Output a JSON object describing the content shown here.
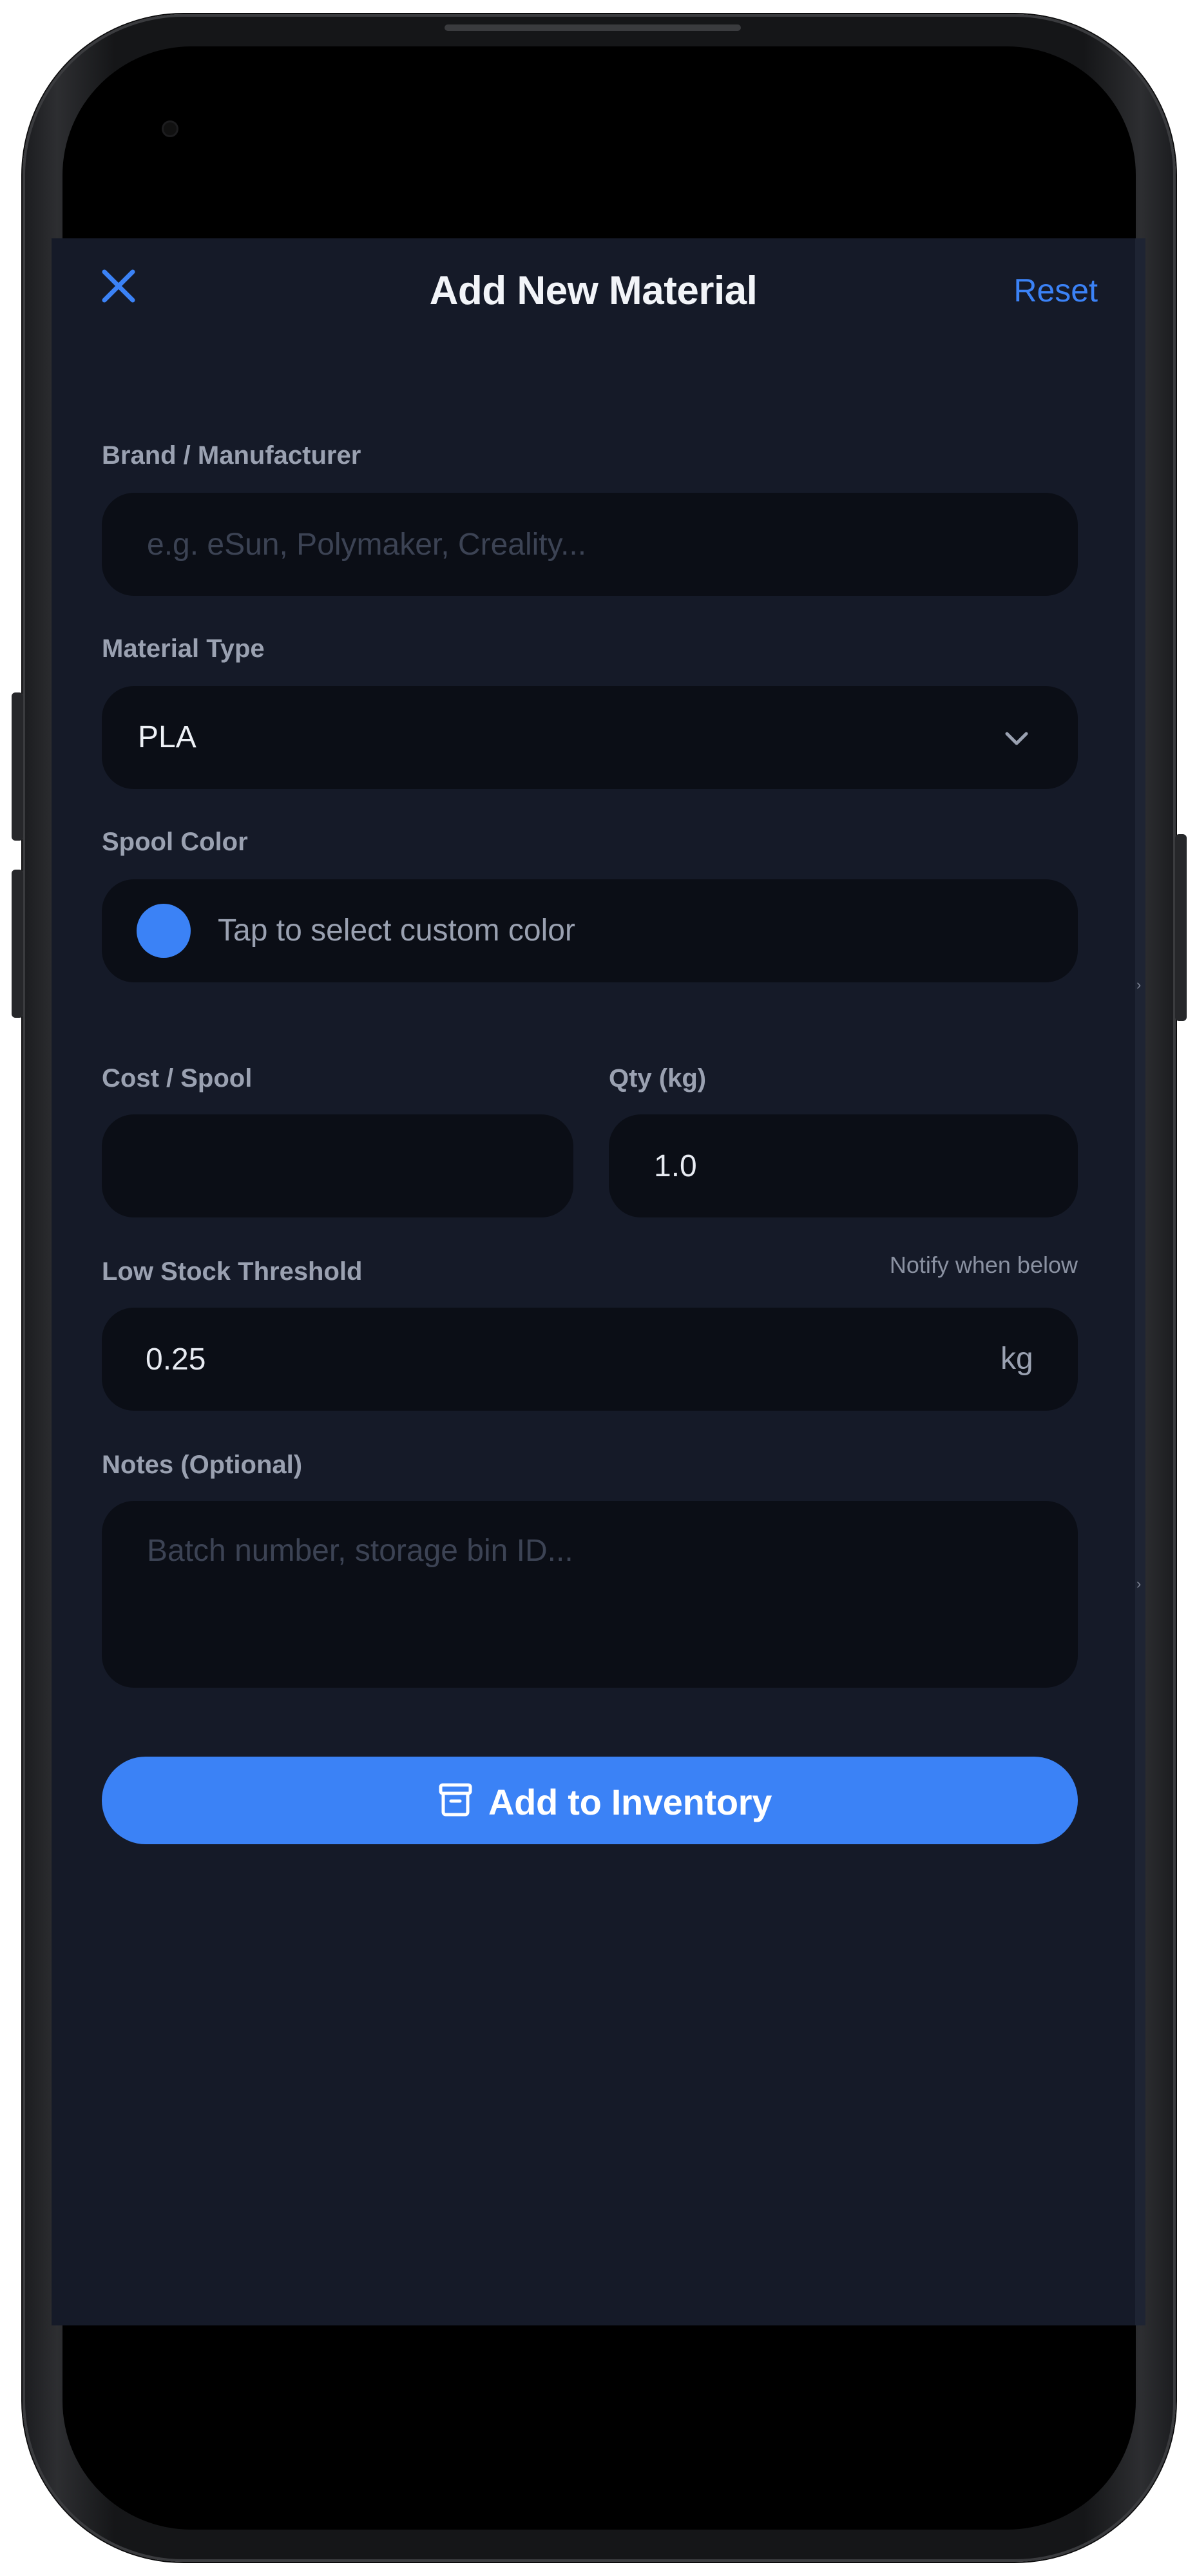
{
  "header": {
    "title": "Add New Material",
    "reset_label": "Reset"
  },
  "form": {
    "brand": {
      "label": "Brand / Manufacturer",
      "placeholder": "e.g. eSun, Polymaker, Creality...",
      "value": ""
    },
    "material_type": {
      "label": "Material Type",
      "selected": "PLA"
    },
    "spool_color": {
      "label": "Spool Color",
      "prompt": "Tap to select custom color",
      "color": "#3b82f6"
    },
    "cost": {
      "label": "Cost / Spool",
      "value": ""
    },
    "qty": {
      "label": "Qty (kg)",
      "value": "1.0"
    },
    "low_stock": {
      "label": "Low Stock Threshold",
      "hint": "Notify when below",
      "value": "0.25",
      "unit": "kg"
    },
    "notes": {
      "label": "Notes (Optional)",
      "placeholder": "Batch number, storage bin ID...",
      "value": ""
    }
  },
  "actions": {
    "submit_label": "Add to Inventory",
    "submit_icon": "archive-box-icon"
  },
  "colors": {
    "accent": "#3b82f6",
    "background": "#151a28",
    "field": "#0b0e16"
  }
}
